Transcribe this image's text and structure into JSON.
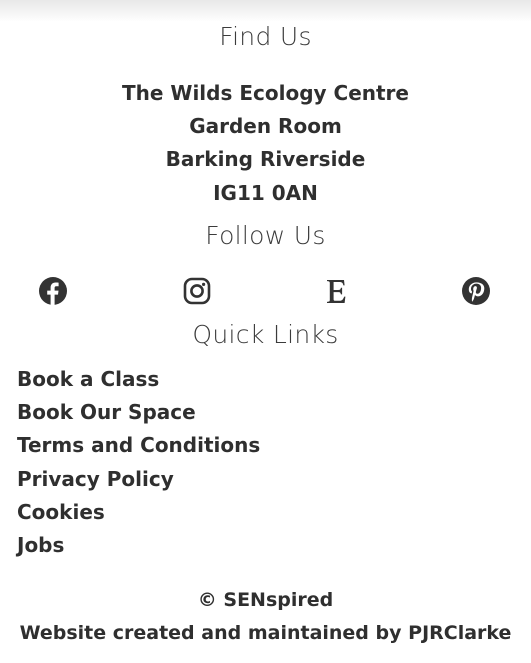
{
  "find_us": {
    "heading": "Find Us",
    "address_lines": [
      "The Wilds Ecology Centre",
      "Garden Room",
      "Barking Riverside",
      "IG11 0AN"
    ]
  },
  "follow_us": {
    "heading": "Follow Us",
    "icons": [
      "facebook-icon",
      "instagram-icon",
      "etsy-icon",
      "pinterest-icon"
    ]
  },
  "quick_links": {
    "heading": "Quick Links",
    "items": [
      "Book a Class",
      "Book Our Space",
      "Terms and Conditions",
      "Privacy Policy",
      "Cookies",
      "Jobs"
    ]
  },
  "footer": {
    "copyright": "© SENspired",
    "credit_prefix": "Website created and maintained by ",
    "credit_name": "PJRClarke"
  },
  "colors": {
    "text": "#2f2f2f",
    "icon": "#333333"
  }
}
